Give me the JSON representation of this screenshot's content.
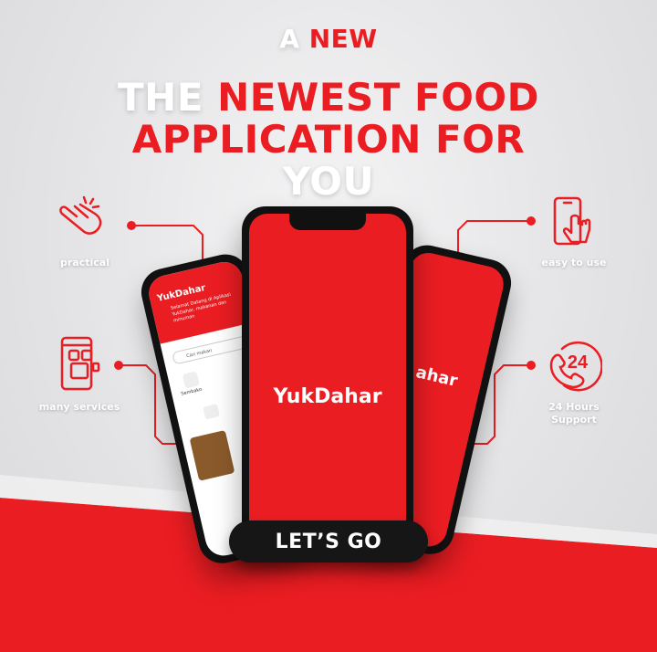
{
  "header": {
    "prefix_white": "A",
    "prefix_red": "NEW",
    "line1_white": "THE",
    "line1_red": "NEWEST FOOD",
    "line2_red": "APPLICATION FOR",
    "line3_white": "YOU"
  },
  "features": {
    "practical": "practical",
    "easy": "easy to use",
    "services": "many services",
    "support_line1": "24 Hours",
    "support_line2": "Support",
    "support_badge": "24"
  },
  "phones": {
    "center_brand": "YukDahar",
    "left_brand": "YukDahar",
    "left_welcome": "Selamat Datang di Aplikasi YukDahar, makanan dan minuman",
    "left_search": "Cari makan",
    "left_item1": "Sembako",
    "right_brand_partial": "ahar"
  },
  "cta": {
    "label": "LET’S GO"
  },
  "colors": {
    "accent": "#ea1d22",
    "dark": "#161616",
    "background": "#e4e4e6"
  }
}
